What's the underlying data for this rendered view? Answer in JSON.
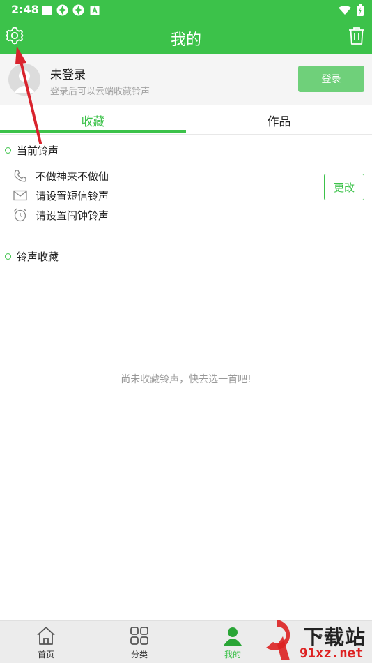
{
  "status_bar": {
    "time": "2:48"
  },
  "header": {
    "title": "我的",
    "settings_icon": "gear-icon",
    "trash_icon": "trash-icon"
  },
  "profile": {
    "name": "未登录",
    "subtitle": "登录后可以云端收藏铃声",
    "login_label": "登录"
  },
  "tabs": [
    {
      "label": "收藏",
      "active": true
    },
    {
      "label": "作品",
      "active": false
    }
  ],
  "current_ringtone": {
    "title": "当前铃声",
    "rows": [
      {
        "icon": "phone-icon",
        "label": "不做神来不做仙"
      },
      {
        "icon": "mail-icon",
        "label": "请设置短信铃声"
      },
      {
        "icon": "alarm-clock-icon",
        "label": "请设置闹钟铃声"
      }
    ],
    "change_label": "更改"
  },
  "favorites": {
    "title": "铃声收藏",
    "empty_text": "尚未收藏铃声，快去选一首吧!"
  },
  "bottom_nav": [
    {
      "icon": "home-icon",
      "label": "首页",
      "active": false
    },
    {
      "icon": "grid-icon",
      "label": "分类",
      "active": false
    },
    {
      "icon": "user-icon",
      "label": "我的",
      "active": true
    },
    {
      "icon": "more-icon",
      "label": "",
      "active": false
    }
  ],
  "watermark": {
    "top": "下载站",
    "bottom": "91xz.net"
  },
  "colors": {
    "brand": "#3cc24a",
    "login_button": "#6fd07a",
    "arrow": "#d9232d"
  }
}
